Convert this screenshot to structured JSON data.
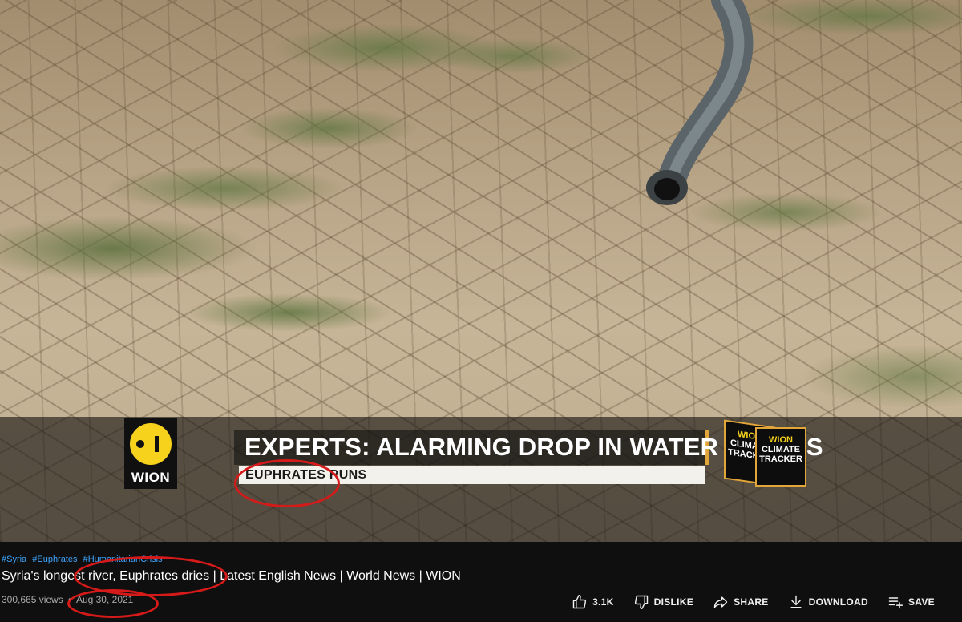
{
  "video_overlay": {
    "channel_logo_text": "WION",
    "headline": "EXPERTS: ALARMING DROP IN WATER LEVELS",
    "ticker": "EUPHRATES RUNS",
    "tracker": {
      "brand": "WION",
      "line1": "CLIMATE",
      "line2": "TRACKER"
    }
  },
  "hashtags": [
    "#Syria",
    "#Euphrates",
    "#HumanitarianCrisis"
  ],
  "video": {
    "title": "Syria's longest river, Euphrates dries | Latest English News | World News | WION",
    "views": "300,665 views",
    "separator": "•",
    "date": "Aug 30, 2021"
  },
  "actions": {
    "like_count": "3.1K",
    "dislike": "DISLIKE",
    "share": "SHARE",
    "download": "DOWNLOAD",
    "save": "SAVE"
  },
  "icons": {
    "like": "thumb-up-icon",
    "dislike": "thumb-down-icon",
    "share": "share-arrow-icon",
    "download": "download-icon",
    "save": "playlist-add-icon"
  },
  "colors": {
    "background": "#0f0f0f",
    "hashtag": "#3ea6ff",
    "meta_text": "#aaaaaa",
    "annotation": "#d61a1a",
    "wion_yellow": "#f6d21c",
    "accent_orange": "#e2a53a"
  }
}
